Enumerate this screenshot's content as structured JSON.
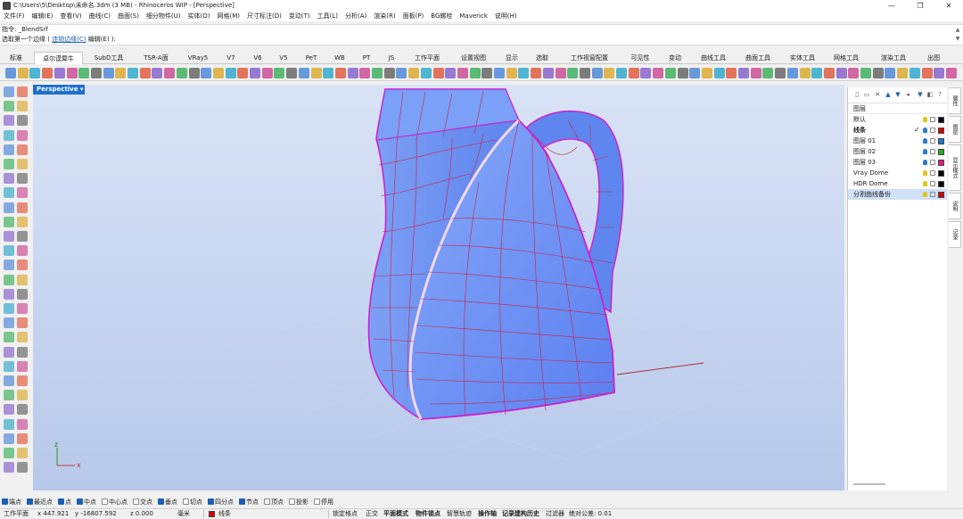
{
  "window": {
    "title": "C:\\Users\\5\\Desktop\\未命名.3dm (3 MB) - Rhinoceros WIP - [Perspective]",
    "minimize_icon": "minimize-icon",
    "maximize_icon": "restore-icon",
    "close_icon": "close-icon"
  },
  "menu": [
    "文件(F)",
    "编辑(E)",
    "查看(V)",
    "曲线(C)",
    "曲面(S)",
    "细分物件(U)",
    "实体(O)",
    "网格(M)",
    "尺寸标注(D)",
    "变动(T)",
    "工具(L)",
    "分析(A)",
    "渲染(R)",
    "面板(P)",
    "BG螺栓",
    "Maverick",
    "说明(H)"
  ],
  "command": {
    "history_line": "指令: _BlendSrf",
    "prompt_prefix": "选取第一个边缘 (",
    "option_chain": "连锁边缘(C)",
    "option_edit": "编辑(E)",
    "prompt_suffix": "):"
  },
  "tabs": [
    "标准",
    "卓尔谟犀牛",
    "SubD工具",
    "TSR-A面",
    "VRay5",
    "V7",
    "V6",
    "V5",
    "PeT",
    "WB",
    "PT",
    "JS",
    "工作平面",
    "设置视图",
    "显示",
    "选取",
    "工作视窗配置",
    "可见性",
    "变动",
    "曲线工具",
    "曲面工具",
    "实体工具",
    "网格工具",
    "渲染工具",
    "出图"
  ],
  "active_tab": "卓尔谟犀牛",
  "viewport": {
    "label": "Perspective",
    "axis_x": "x",
    "axis_y": "y",
    "axis_z": "z"
  },
  "layers": {
    "header": "图层",
    "items": [
      {
        "name": "默认",
        "color": "#000000",
        "bold": false,
        "selected": false,
        "current": false
      },
      {
        "name": "线条",
        "color": "#e00000",
        "bold": true,
        "selected": false,
        "current": true
      },
      {
        "name": "图层 01",
        "color": "#1f77d0",
        "bold": false,
        "selected": false,
        "current": false
      },
      {
        "name": "图层 02",
        "color": "#19b319",
        "bold": false,
        "selected": false,
        "current": false
      },
      {
        "name": "图层 03",
        "color": "#e0197a",
        "bold": false,
        "selected": false,
        "current": false
      },
      {
        "name": "Vray Dome",
        "color": "#000000",
        "bold": false,
        "selected": false,
        "current": false
      },
      {
        "name": "HDR Dome",
        "color": "#000000",
        "bold": false,
        "selected": false,
        "current": false
      },
      {
        "name": "分割曲线备份",
        "color": "#e00000",
        "bold": false,
        "selected": true,
        "current": false
      }
    ],
    "checkmark": "✓"
  },
  "side_tabs": [
    "属性",
    "图层",
    "显示模式",
    "说明",
    "记录"
  ],
  "osnaps": [
    {
      "label": "端点",
      "on": true
    },
    {
      "label": "最近点",
      "on": true
    },
    {
      "label": "点",
      "on": true
    },
    {
      "label": "中点",
      "on": true
    },
    {
      "label": "中心点",
      "on": false
    },
    {
      "label": "交点",
      "on": false
    },
    {
      "label": "垂点",
      "on": true
    },
    {
      "label": "切点",
      "on": false
    },
    {
      "label": "四分点",
      "on": true
    },
    {
      "label": "节点",
      "on": true
    },
    {
      "label": "顶点",
      "on": false
    },
    {
      "label": "投影",
      "on": false
    },
    {
      "label": "停用",
      "on": false
    }
  ],
  "status": {
    "cplane": "工作平面",
    "x": "x 447.921",
    "y": "y -16807.592",
    "z": "z 0.000",
    "unit": "毫米",
    "layer": "线条",
    "layer_color": "#e00000",
    "toggles": [
      "锁定格点",
      "正交",
      "平面模式",
      "物件锁点",
      "智慧轨迹",
      "操作轴",
      "记录建构历史",
      "过滤器"
    ],
    "toggles_bold": [
      false,
      false,
      true,
      true,
      false,
      true,
      true,
      false
    ],
    "tolerance": "绝对公差: 0.01"
  }
}
